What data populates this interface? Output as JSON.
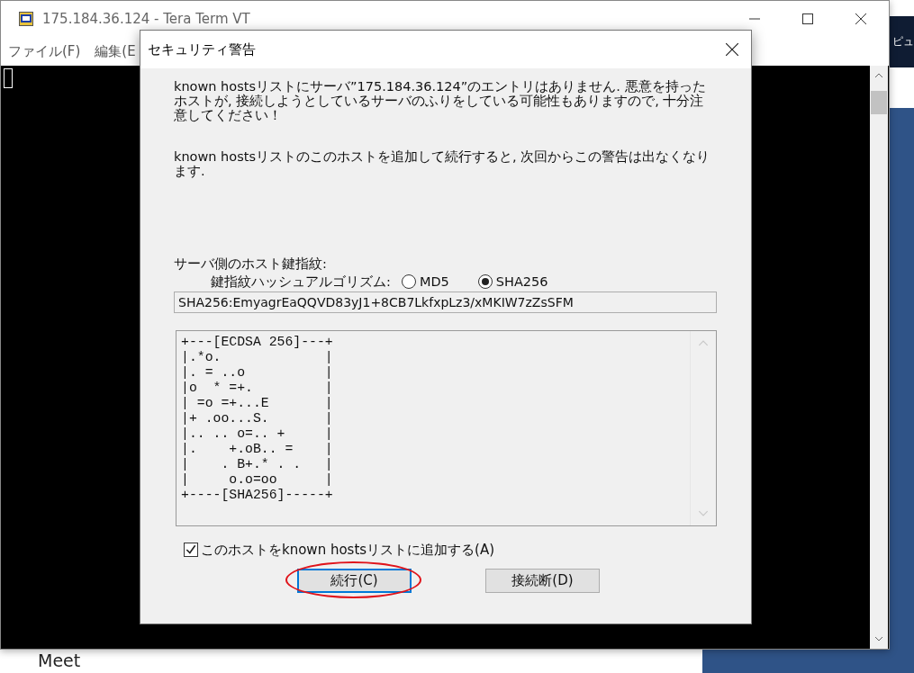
{
  "background_page": {
    "side_text": "ピュ",
    "footer_text": "Meet"
  },
  "terminal_window": {
    "title": "175.184.36.124 - Tera Term VT",
    "menu": [
      "ファイル(F)",
      "編集(E"
    ]
  },
  "dialog": {
    "title": "セキュリティ警告",
    "messages": [
      "known hostsリストにサーバ”175.184.36.124”のエントリはありません. 悪意を持ったホストが, 接続しようとしているサーバのふりをしている可能性もありますので, 十分注意してください！",
      "known hostsリストのこのホストを追加して続行すると, 次回からこの警告は出なくなります."
    ],
    "fingerprint_label": "サーバ側のホスト鍵指紋:",
    "hash_label": "鍵指紋ハッシュアルゴリズム:",
    "hash_options": [
      {
        "label": "MD5",
        "selected": false
      },
      {
        "label": "SHA256",
        "selected": true
      }
    ],
    "fingerprint": "SHA256:EmyagrEaQQVD83yJ1+8CB7LkfxpLz3/xMKIW7zZsSFM",
    "randomart": [
      "+---[ECDSA 256]---+",
      "|.*o.             |",
      "|. = ..o          |",
      "|o  * =+.         |",
      "| =o =+...E       |",
      "|+ .oo...S.       |",
      "|.. .. o=.. +     |",
      "|.    +.oB.. =    |",
      "|    . B+.* . .   |",
      "|     o.o=oo      |",
      "+----[SHA256]-----+"
    ],
    "add_host": {
      "label": "このホストをknown hostsリストに追加する(A)",
      "checked": true
    },
    "buttons": [
      {
        "label": "続行(C)",
        "focused": true,
        "highlighted": true
      },
      {
        "label": "接続断(D)",
        "focused": false,
        "highlighted": false
      }
    ]
  }
}
